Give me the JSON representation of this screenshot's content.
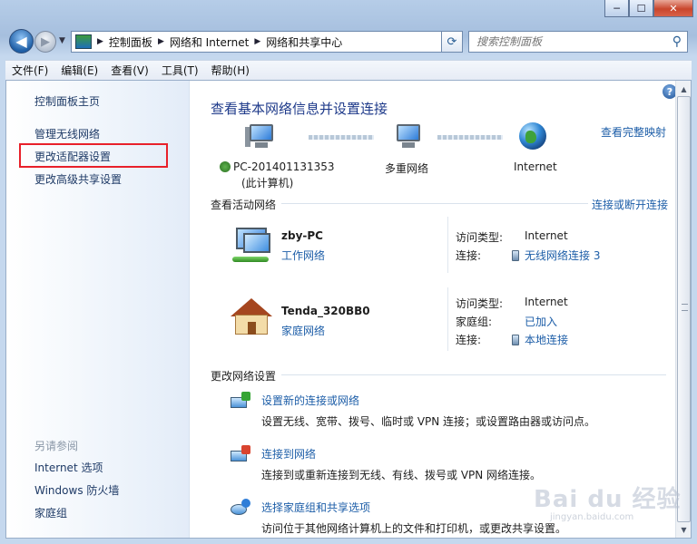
{
  "window": {
    "buttons": {
      "minimize": "─",
      "maximize": "☐",
      "close": "✕"
    }
  },
  "nav": {
    "breadcrumb": [
      "控制面板",
      "网络和 Internet",
      "网络和共享中心"
    ],
    "search_placeholder": "搜索控制面板"
  },
  "menu": [
    "文件(F)",
    "编辑(E)",
    "查看(V)",
    "工具(T)",
    "帮助(H)"
  ],
  "sidebar": {
    "home": "控制面板主页",
    "links": [
      "管理无线网络",
      "更改适配器设置",
      "更改高级共享设置"
    ],
    "see_also_heading": "另请参阅",
    "see_also": [
      "Internet 选项",
      "Windows 防火墙",
      "家庭组"
    ]
  },
  "main": {
    "title": "查看基本网络信息并设置连接",
    "full_map_link": "查看完整映射",
    "map": {
      "computer_name": "PC-201401131353",
      "computer_sub": "(此计算机)",
      "middle_label": "多重网络",
      "internet_label": "Internet"
    },
    "active_header": "查看活动网络",
    "connect_disconnect_link": "连接或断开连接",
    "networks": [
      {
        "name": "zby-PC",
        "type": "工作网络",
        "access_type_key": "访问类型:",
        "access_type_val": "Internet",
        "conn_key": "连接:",
        "conn_val": "无线网络连接 3"
      },
      {
        "name": "Tenda_320BB0",
        "type": "家庭网络",
        "access_type_key": "访问类型:",
        "access_type_val": "Internet",
        "homegroup_key": "家庭组:",
        "homegroup_val": "已加入",
        "conn_key": "连接:",
        "conn_val": "本地连接"
      }
    ],
    "change_header": "更改网络设置",
    "tasks": [
      {
        "link": "设置新的连接或网络",
        "desc": "设置无线、宽带、拨号、临时或 VPN 连接；或设置路由器或访问点。"
      },
      {
        "link": "连接到网络",
        "desc": "连接到或重新连接到无线、有线、拨号或 VPN 网络连接。"
      },
      {
        "link": "选择家庭组和共享选项",
        "desc": "访问位于其他网络计算机上的文件和打印机，或更改共享设置。"
      }
    ]
  },
  "watermark": {
    "text": "Bai du 经验",
    "sub": "jingyan.baidu.com"
  }
}
